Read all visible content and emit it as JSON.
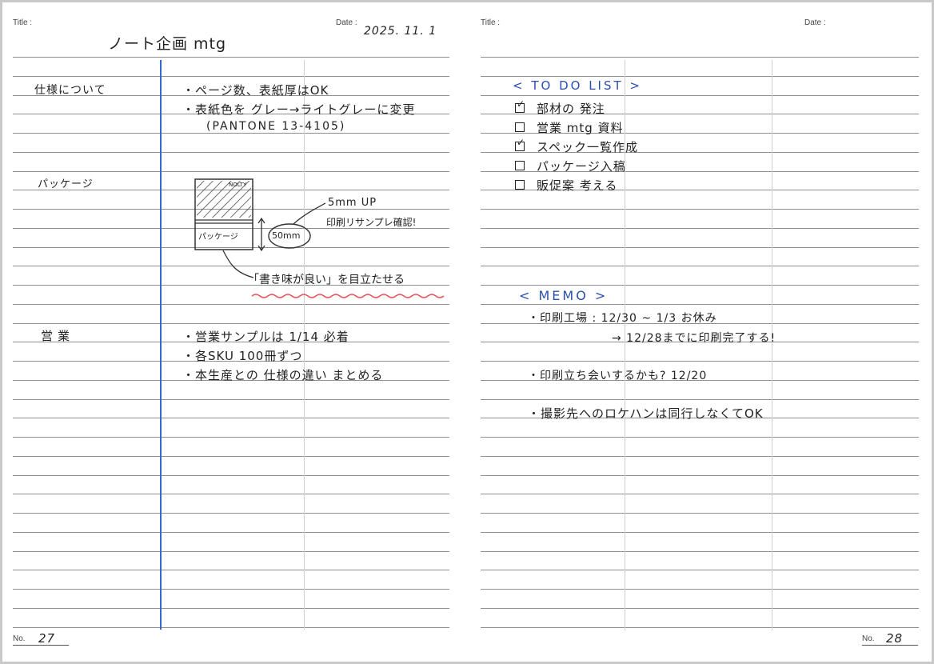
{
  "left_page": {
    "title_label": "Title :",
    "date_label": "Date :",
    "title": "ノート企画 mtg",
    "date": "2025. 11. 1",
    "sections": [
      {
        "heading": "仕様について",
        "lines": [
          "・ページ数、表紙厚はOK",
          "・表紙色を グレー→ライトグレーに変更",
          "(PANTONE   13-4105)"
        ]
      },
      {
        "heading": "パッケージ",
        "sketch": {
          "box_top_label": "NOLTY",
          "box_bottom_label": "パッケージ",
          "dimension": "50mm",
          "note_line1": "5mm UP",
          "note_line2": "印刷リサンプレ確認!"
        },
        "caption": "「書き味が良い」を目立たせる"
      },
      {
        "heading": "営業",
        "lines": [
          "・営業サンプルは 1/14 必着",
          "・各SKU  100冊ずつ",
          "・本生産との 仕様の違い まとめる"
        ]
      }
    ],
    "page_no_label": "No.",
    "page_no": "27"
  },
  "right_page": {
    "title_label": "Title :",
    "date_label": "Date :",
    "todo_heading": "< TO DO LIST >",
    "todo": [
      {
        "text": "部材の 発注",
        "checked": true
      },
      {
        "text": "営業 mtg 資料",
        "checked": false
      },
      {
        "text": "スペック一覧作成",
        "checked": true
      },
      {
        "text": "パッケージ入稿",
        "checked": false
      },
      {
        "text": "販促案 考える",
        "checked": false
      }
    ],
    "memo_heading": "< MEMO >",
    "memo": [
      "・印刷工場 : 12/30 ~ 1/3  お休み",
      "→ 12/28までに印刷完了する!",
      "・印刷立ち会いするかも?    12/20",
      "・撮影先へのロケハンは同行しなくてOK"
    ],
    "page_no_label": "No.",
    "page_no": "28"
  },
  "colors": {
    "rule": "#8f8f8f",
    "margin_line": "#2f6bc9",
    "ink_blue": "#2a4fb0",
    "highlight_wave": "#e8575f"
  }
}
